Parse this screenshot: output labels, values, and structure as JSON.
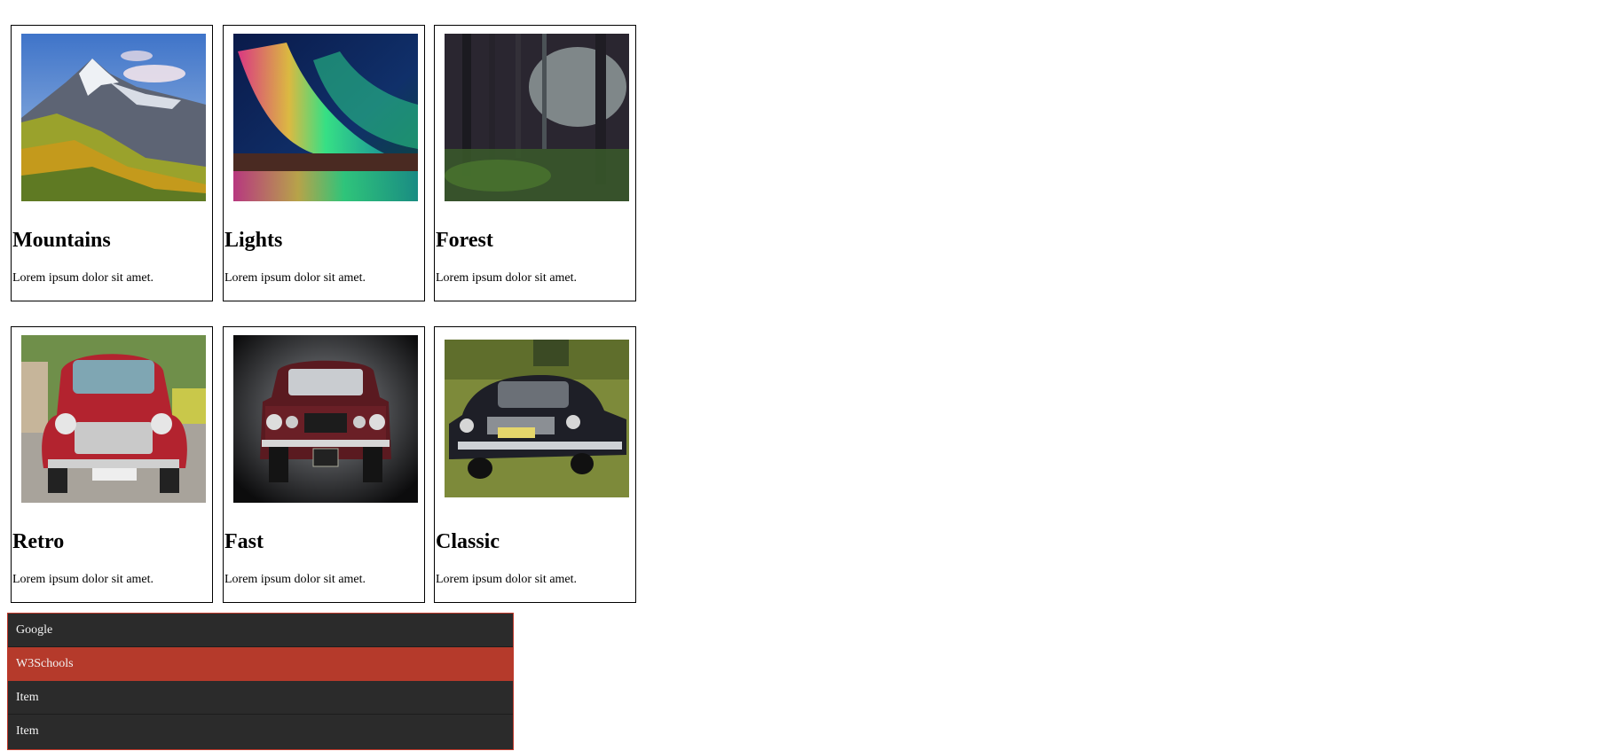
{
  "gallery": {
    "cards": [
      {
        "title": "Mountains",
        "caption": "Lorem ipsum dolor sit amet.",
        "image": "mountains-photo"
      },
      {
        "title": "Lights",
        "caption": "Lorem ipsum dolor sit amet.",
        "image": "aurora-photo"
      },
      {
        "title": "Forest",
        "caption": "Lorem ipsum dolor sit amet.",
        "image": "forest-photo"
      },
      {
        "title": "Retro",
        "caption": "Lorem ipsum dolor sit amet.",
        "image": "red-mini-car-photo"
      },
      {
        "title": "Fast",
        "caption": "Lorem ipsum dolor sit amet.",
        "image": "red-mustang-photo"
      },
      {
        "title": "Classic",
        "caption": "Lorem ipsum dolor sit amet.",
        "image": "black-classic-car-photo"
      }
    ]
  },
  "menu": {
    "items": [
      {
        "label": "Google",
        "active": false
      },
      {
        "label": "W3Schools",
        "active": true
      },
      {
        "label": "Item",
        "active": false
      },
      {
        "label": "Item",
        "active": false
      }
    ],
    "colors": {
      "background": "#2b2b2b",
      "active": "#b53a2b",
      "border": "#c0392b",
      "text": "#f2f2f2"
    }
  }
}
